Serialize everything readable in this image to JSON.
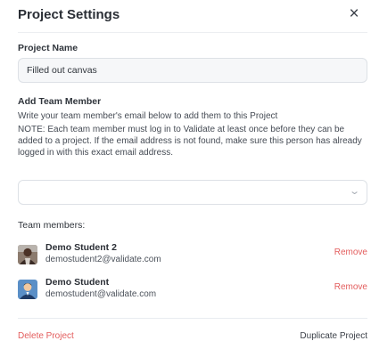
{
  "dialog": {
    "title": "Project Settings",
    "close_icon": "×"
  },
  "project_name": {
    "label": "Project Name",
    "value": "Filled out canvas"
  },
  "add_member": {
    "label": "Add Team Member",
    "help_line": "Write your team member's email below to add them to this Project",
    "note": "NOTE: Each team member must log in to Validate at least once before they can be added to a project. If the email address is not found, make sure this person has already logged in with this exact email address.",
    "select_value": "",
    "chevron_icon": "chevron-down-icon"
  },
  "team": {
    "label": "Team members:",
    "members": [
      {
        "name": "Demo Student 2",
        "email": "demostudent2@validate.com",
        "remove_label": "Remove"
      },
      {
        "name": "Demo Student",
        "email": "demostudent@validate.com",
        "remove_label": "Remove"
      }
    ]
  },
  "footer": {
    "delete_label": "Delete Project",
    "duplicate_label": "Duplicate Project"
  },
  "colors": {
    "danger": "#e35d5d",
    "divider": "#eceef1",
    "input_bg": "#f6f7f9"
  }
}
